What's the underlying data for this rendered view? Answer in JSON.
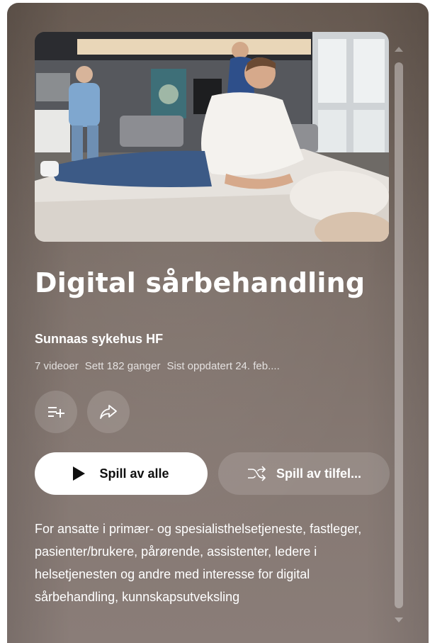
{
  "playlist": {
    "title": "Digital sårbehandling",
    "channel": "Sunnaas sykehus HF",
    "meta": {
      "video_count": "7 videoer",
      "views": "Sett 182 ganger",
      "updated": "Sist oppdatert 24. feb...."
    },
    "actions": {
      "save_icon": "playlist-add-icon",
      "share_icon": "share-icon"
    },
    "buttons": {
      "play_all": "Spill av alle",
      "shuffle": "Spill av tilfel..."
    },
    "description": "For ansatte i primær- og spesialisthelsetjeneste, fastleger, pasienter/brukere, pårørende, assistenter, ledere i helsetjenesten og andre med interesse for digital sårbehandling, kunnskapsutveksling"
  },
  "colors": {
    "panel_top": "#65584f",
    "panel_bottom": "#8a7d78",
    "primary_button": "#ffffff",
    "text": "#ffffff"
  }
}
